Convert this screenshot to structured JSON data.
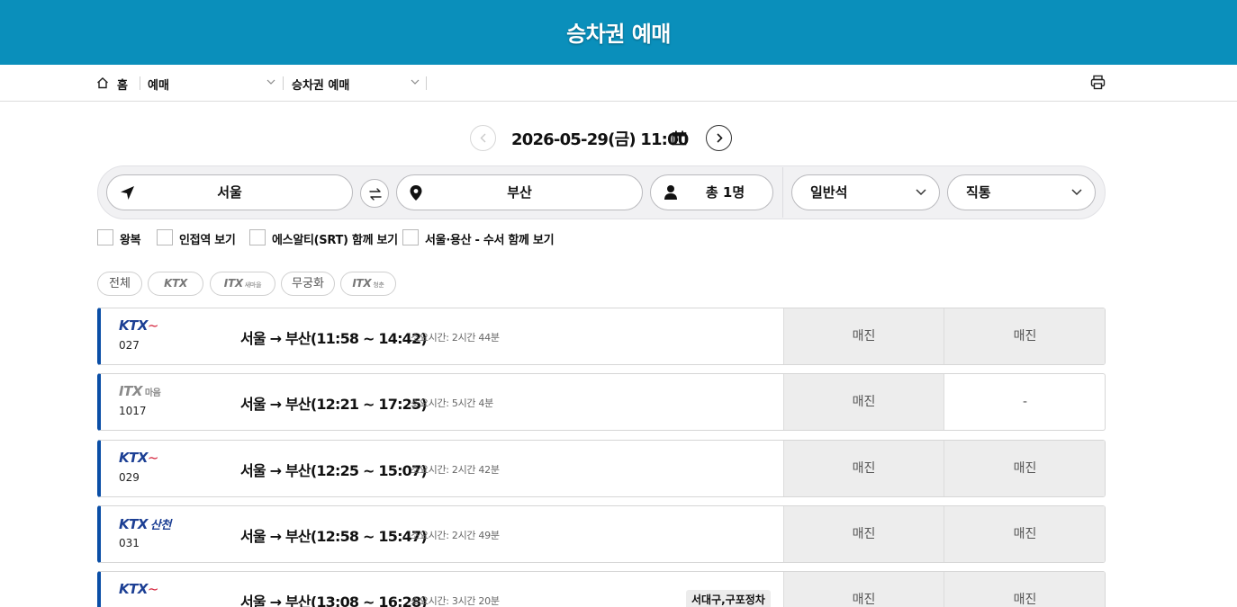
{
  "header": {
    "title": "승차권 예매"
  },
  "breadcrumb": {
    "home": "홈",
    "level1": "예매",
    "level2": "승차권 예매"
  },
  "date_nav": {
    "datetime": "2026-05-29(금) 11:00"
  },
  "search": {
    "departure": "서울",
    "arrival": "부산",
    "passengers": "총 1명",
    "seat_class": "일반석",
    "route_type": "직통"
  },
  "options": [
    {
      "label": "왕복",
      "checked": false
    },
    {
      "label": "인접역 보기",
      "checked": false
    },
    {
      "label": "에스알티(SRT) 함께 보기",
      "checked": false
    },
    {
      "label": "서울·용산 - 수서 함께 보기",
      "checked": false
    }
  ],
  "filters": {
    "all": "전체",
    "ktx": "KTX",
    "itx_maeum": "ITX",
    "itx_maeum_sub": "새마을",
    "mugunghwa": "무궁화",
    "itx_cheongchun": "ITX",
    "itx_cheongchun_sub": "청춘"
  },
  "trains": [
    {
      "brand": "KTX",
      "brand_sub": "",
      "number": "027",
      "route": "서울 → 부산(11:58 ~ 14:42)",
      "duration": "소요시간: 2시간 44분",
      "note": "",
      "general": "매진",
      "special": "매진"
    },
    {
      "brand": "ITX",
      "brand_sub": "마음",
      "number": "1017",
      "route": "서울 → 부산(12:21 ~ 17:25)",
      "duration": "소요시간: 5시간 4분",
      "note": "",
      "general": "매진",
      "special": "-"
    },
    {
      "brand": "KTX",
      "brand_sub": "",
      "number": "029",
      "route": "서울 → 부산(12:25 ~ 15:07)",
      "duration": "소요시간: 2시간 42분",
      "note": "",
      "general": "매진",
      "special": "매진"
    },
    {
      "brand": "KTX",
      "brand_sub": "산천",
      "number": "031",
      "route": "서울 → 부산(12:58 ~ 15:47)",
      "duration": "소요시간: 2시간 49분",
      "note": "",
      "general": "매진",
      "special": "매진"
    },
    {
      "brand": "KTX",
      "brand_sub": "",
      "number": "",
      "route": "서울 → 부산(13:08 ~ 16:28)",
      "duration": "소요시간: 3시간 20분",
      "note": "서대구,구포정차",
      "general": "매진",
      "special": "매진"
    }
  ],
  "colors": {
    "header_bg": "#0a8fbb",
    "row_accent": "#0a4ea6",
    "soldout_bg": "#ededed",
    "ktx_blue": "#1c3f94",
    "ktx_red": "#d4213a"
  }
}
